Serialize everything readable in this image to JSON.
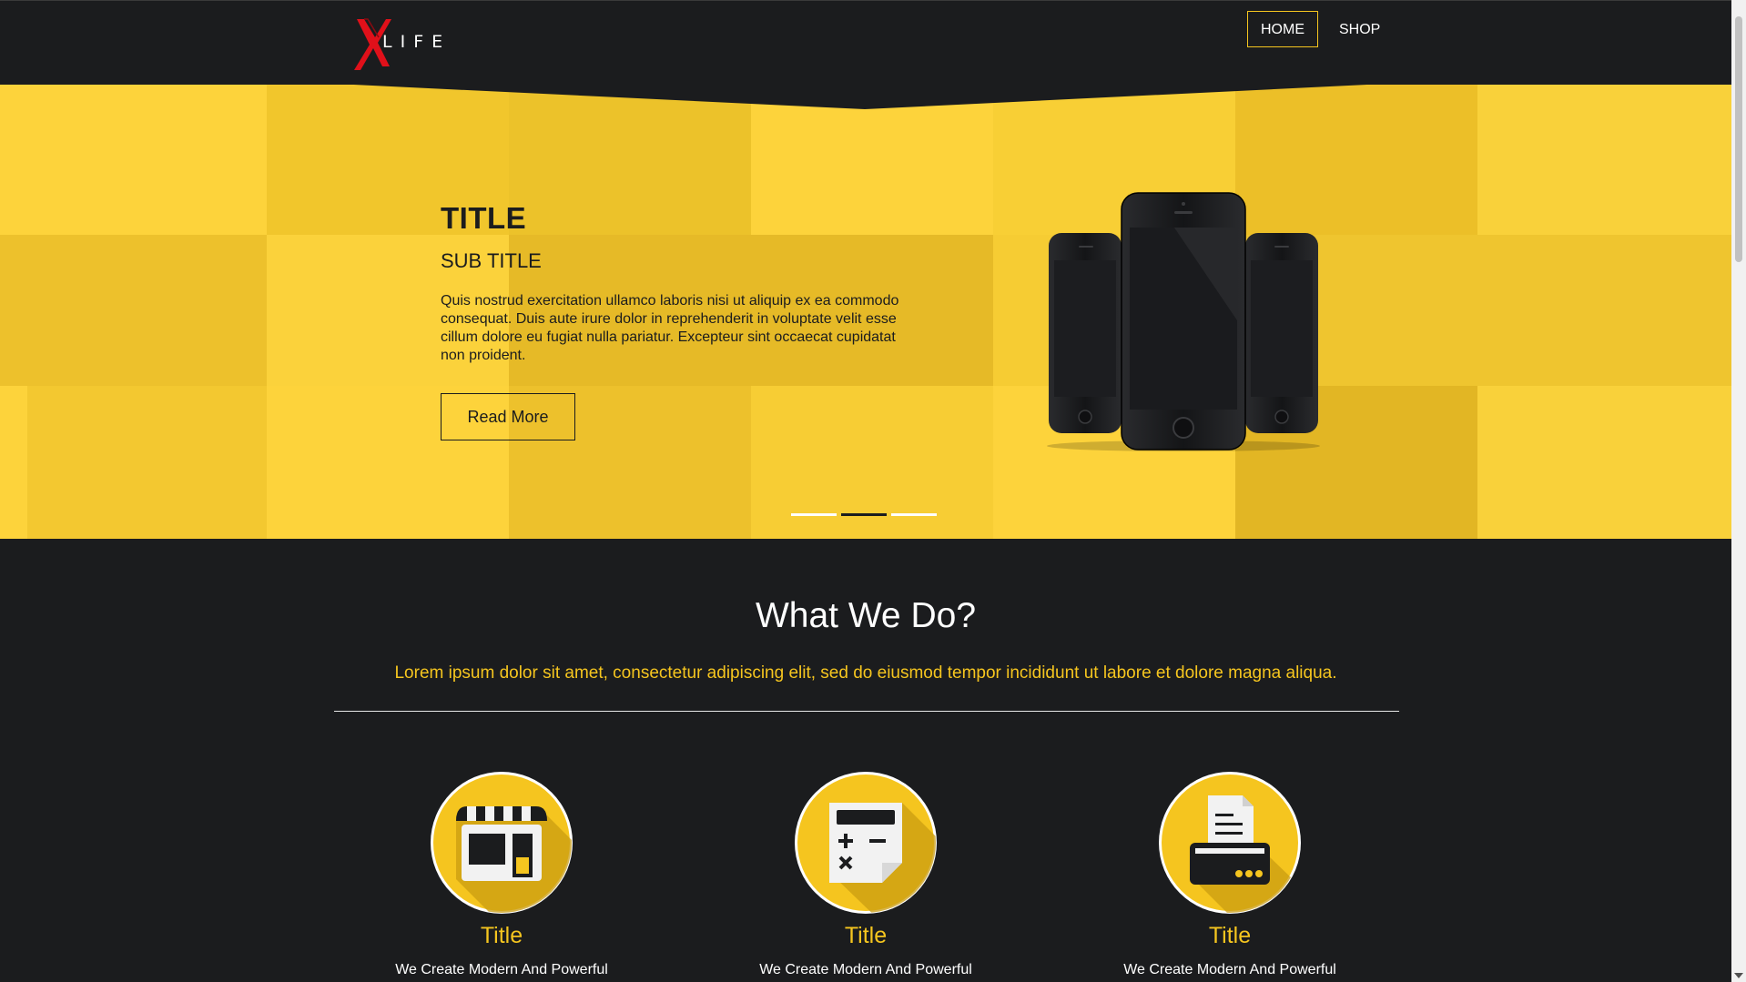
{
  "header": {
    "logo_text": "LIFE",
    "nav": [
      {
        "label": "HOME",
        "active": true
      },
      {
        "label": "SHOP",
        "active": false
      }
    ]
  },
  "hero": {
    "title": "TITLE",
    "subtitle": "SUB TITLE",
    "body": "Quis nostrud exercitation ullamco laboris nisi ut aliquip ex ea commodo consequat. Duis aute irure dolor in reprehenderit in voluptate velit esse cillum dolore eu fugiat nulla pariatur. Excepteur sint occaecat cupidatat non proident.",
    "button_label": "Read More",
    "slides_total": 3,
    "active_slide": 2
  },
  "what_we_do": {
    "title": "What We Do?",
    "lead": "Lorem ipsum dolor sit amet, consectetur adipiscing elit, sed do eiusmod tempor incididunt ut labore et dolore magna aliqua.",
    "features": [
      {
        "icon": "shop-icon",
        "title": "Title",
        "text": "We Create Modern And Powerful"
      },
      {
        "icon": "calculator-icon",
        "title": "Title",
        "text": "We Create Modern And Powerful"
      },
      {
        "icon": "printer-icon",
        "title": "Title",
        "text": "We Create Modern And Powerful"
      }
    ]
  },
  "colors": {
    "accent": "#f5c51f",
    "hero_bg": "#fdd33b",
    "dark_bg": "#1b1c1e",
    "logo_red": "#e0101a"
  }
}
